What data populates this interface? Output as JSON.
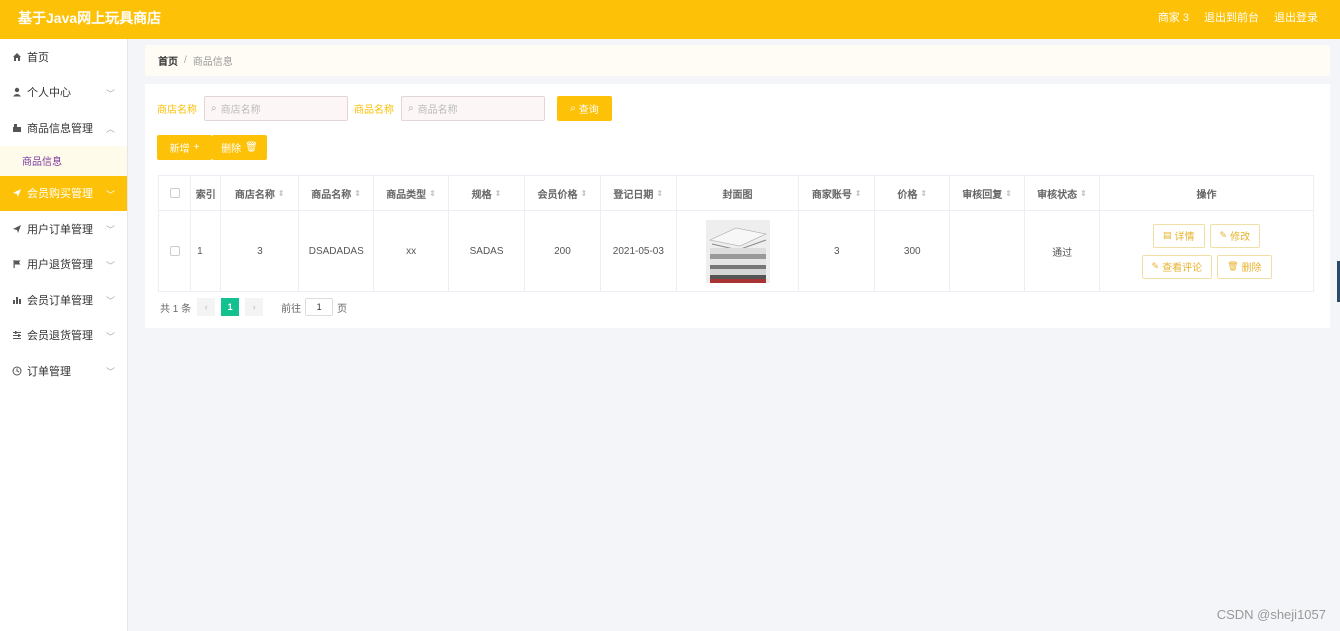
{
  "app": {
    "title": "基于Java网上玩具商店",
    "user_label": "商家 3",
    "back_to_front": "退出到前台",
    "logout": "退出登录"
  },
  "sidebar": {
    "items": [
      {
        "label": "首页",
        "icon": "home-icon"
      },
      {
        "label": "个人中心",
        "icon": "user-icon"
      },
      {
        "label": "商品信息管理",
        "icon": "shop-icon"
      },
      {
        "label": "会员购买管理",
        "icon": "send-icon"
      },
      {
        "label": "用户订单管理",
        "icon": "send-icon"
      },
      {
        "label": "用户退货管理",
        "icon": "flag-icon"
      },
      {
        "label": "会员订单管理",
        "icon": "chart-icon"
      },
      {
        "label": "会员退货管理",
        "icon": "filter-icon"
      },
      {
        "label": "订单管理",
        "icon": "clock-icon"
      }
    ],
    "submenu_label": "商品信息"
  },
  "breadcrumb": {
    "home": "首页",
    "separator": "/",
    "current": "商品信息"
  },
  "search": {
    "shop_label": "商店名称",
    "shop_placeholder": "商店名称",
    "product_label": "商品名称",
    "product_placeholder": "商品名称",
    "query_button": "查询"
  },
  "actions": {
    "add": "新增",
    "delete": "删除"
  },
  "table": {
    "headers": [
      "索引",
      "商店名称",
      "商品名称",
      "商品类型",
      "规格",
      "会员价格",
      "登记日期",
      "封面图",
      "商家账号",
      "价格",
      "审核回复",
      "审核状态",
      "操作"
    ],
    "rows": [
      {
        "index": "1",
        "shop": "3",
        "name": "DSADADAS",
        "type": "xx",
        "spec": "SADAS",
        "member_price": "200",
        "date": "2021-05-03",
        "account": "3",
        "price": "300",
        "reply": "",
        "status": "通过"
      }
    ],
    "ops": {
      "detail": "详情",
      "edit": "修改",
      "comments": "查看评论",
      "delete": "删除"
    }
  },
  "pager": {
    "total": "共 1 条",
    "prev": "‹",
    "current": "1",
    "next": "›",
    "goto_prefix": "前往",
    "goto_value": "1",
    "goto_suffix": "页"
  },
  "watermark": "CSDN @sheji1057",
  "colors": {
    "accent": "#fdc107",
    "pager_active": "#13c08f"
  }
}
